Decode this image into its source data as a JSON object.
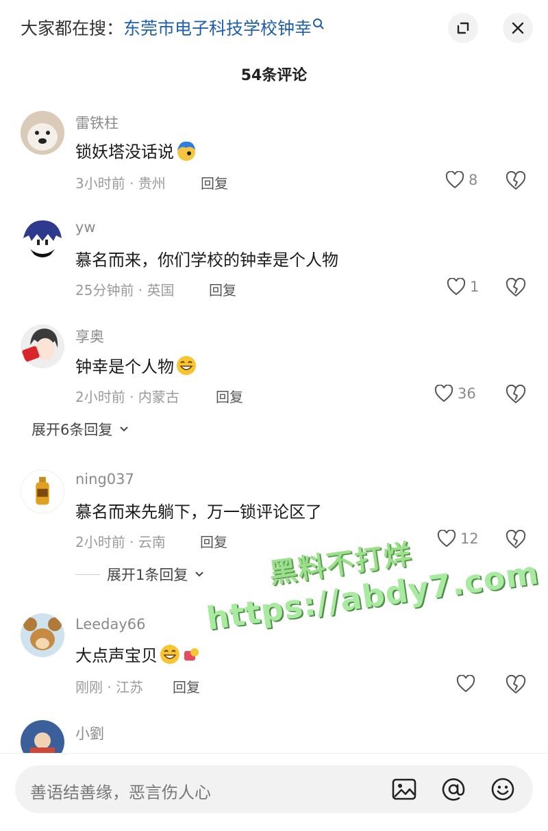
{
  "header": {
    "search_prefix": "大家都在搜：",
    "search_keyword": "东莞市电子科技学校钟幸",
    "comment_count": "54条评论"
  },
  "comments": [
    {
      "user": "雷铁柱",
      "text": "锁妖塔没话说",
      "time": "3小时前 · 贵州",
      "reply": "回复",
      "likes": "8",
      "emoji": "blue-face-emoji"
    },
    {
      "user": "yw",
      "text": "慕名而来，你们学校的钟幸是个人物",
      "time": "25分钟前 · 英国",
      "reply": "回复",
      "likes": "1"
    },
    {
      "user": "享奥",
      "text": "钟幸是个人物",
      "time": "2小时前 · 内蒙古",
      "reply": "回复",
      "likes": "36",
      "expand": "展开6条回复",
      "emoji": "grin-emoji"
    },
    {
      "user": "ning037",
      "text": "慕名而来先躺下，万一锁评论区了",
      "time": "2小时前 · 云南",
      "reply": "回复",
      "likes": "12",
      "expand": "展开1条回复"
    },
    {
      "user": "Leeday66",
      "text": "大点声宝贝",
      "time": "刚刚 · 江苏",
      "reply": "回复",
      "likes": "",
      "emoji": "grin-emoji"
    },
    {
      "user": "小劉",
      "text": "",
      "time": "",
      "reply": "",
      "likes": ""
    }
  ],
  "watermark": {
    "line1": "黑料不打烊",
    "line2": "https://abdy7.com"
  },
  "input": {
    "placeholder": "善语结善缘，恶言伤人心"
  },
  "colors": {
    "keyword": "#1f5fa8",
    "watermark": "#9be08a"
  },
  "icons": [
    "expand-icon",
    "close-icon",
    "heart-icon",
    "dislike-heart-icon",
    "image-icon",
    "at-icon",
    "smiley-icon"
  ]
}
